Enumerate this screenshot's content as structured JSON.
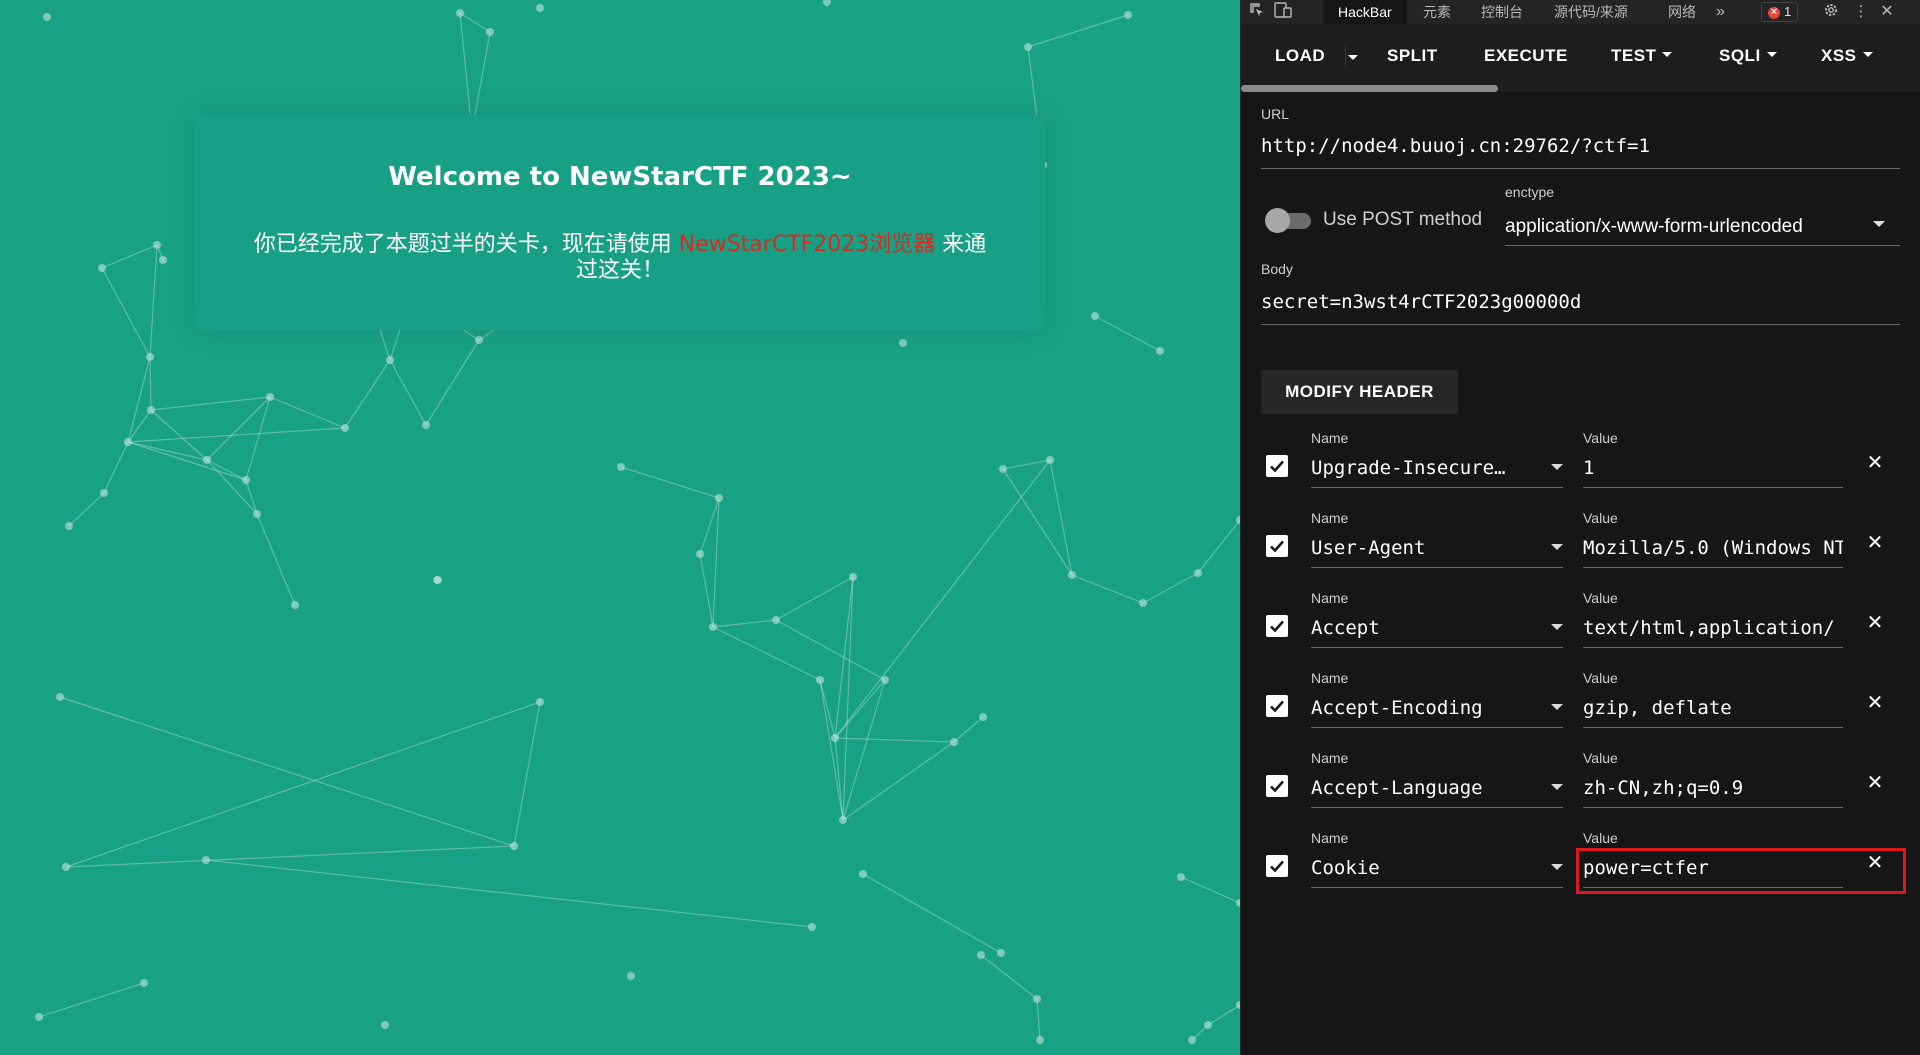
{
  "page": {
    "title": "Welcome to NewStarCTF 2023~",
    "text_before": "你已经完成了本题过半的关卡，现在请使用 ",
    "text_highlight": "NewStarCTF2023浏览器",
    "text_after": " 来通过这关！",
    "background_color": "#19a185",
    "highlight_color": "#d42b1f"
  },
  "devtools": {
    "tabs": [
      "HackBar",
      "元素",
      "控制台",
      "源代码/来源",
      "网络"
    ],
    "more_tabs": "»",
    "error_count": "1"
  },
  "hackbar": {
    "toolbar": {
      "load": "LOAD",
      "split": "SPLIT",
      "execute": "EXECUTE",
      "test": "TEST",
      "sqli": "SQLI",
      "xss": "XSS"
    },
    "url_label": "URL",
    "url": "http://node4.buuoj.cn:29762/?ctf=1",
    "post_label": "Use POST method",
    "post_enabled": false,
    "enctype_label": "enctype",
    "enctype": "application/x-www-form-urlencoded",
    "body_label": "Body",
    "body": "secret=n3wst4rCTF2023g00000d",
    "modify_header": "MODIFY HEADER",
    "name_label": "Name",
    "value_label": "Value",
    "headers": [
      {
        "name": "Upgrade-Insecure-Requests",
        "value": "1",
        "checked": true
      },
      {
        "name": "User-Agent",
        "value": "Mozilla/5.0 (Windows NT",
        "checked": true
      },
      {
        "name": "Accept",
        "value": "text/html,application/",
        "checked": true
      },
      {
        "name": "Accept-Encoding",
        "value": "gzip, deflate",
        "checked": true
      },
      {
        "name": "Accept-Language",
        "value": "zh-CN,zh;q=0.9",
        "checked": true
      },
      {
        "name": "Cookie",
        "value": "power=ctfer",
        "checked": true
      }
    ],
    "highlight_color": "#e0161d"
  }
}
